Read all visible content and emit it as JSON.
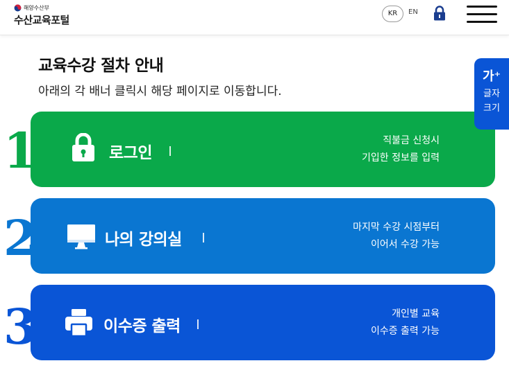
{
  "header": {
    "ministry": "해양수산부",
    "portal_name": "수산교육포털",
    "lang_kr": "KR",
    "lang_en": "EN",
    "icons": {
      "lock": "lock-icon",
      "menu": "hamburger-menu-icon",
      "emblem": "taegeuk-emblem-icon"
    }
  },
  "intro": {
    "title": "교육수강 절차 안내",
    "subtitle": "아래의 각 배너 클릭시 해당 페이지로 이동합니다."
  },
  "font_widget": {
    "icon_label": "가⁺",
    "line1": "글자",
    "line2": "크기"
  },
  "steps": [
    {
      "number": "1",
      "title": "로그인",
      "desc1": "직불금 신청시",
      "desc2": "기입한 정보를 입력",
      "color": "#0aa94a",
      "number_color": "#0aa94a",
      "icon": "lock-icon"
    },
    {
      "number": "2",
      "title": "나의 강의실",
      "desc1": "마지막 수강 시점부터",
      "desc2": "이어서 수강 가능",
      "color": "#0a76d1",
      "number_color": "#0a76d1",
      "icon": "monitor-icon"
    },
    {
      "number": "3",
      "title": "이수증 출력",
      "desc1": "개인별 교육",
      "desc2": "이수증 출력 가능",
      "color": "#0a55d6",
      "number_color": "#0a55d6",
      "icon": "printer-icon"
    }
  ]
}
